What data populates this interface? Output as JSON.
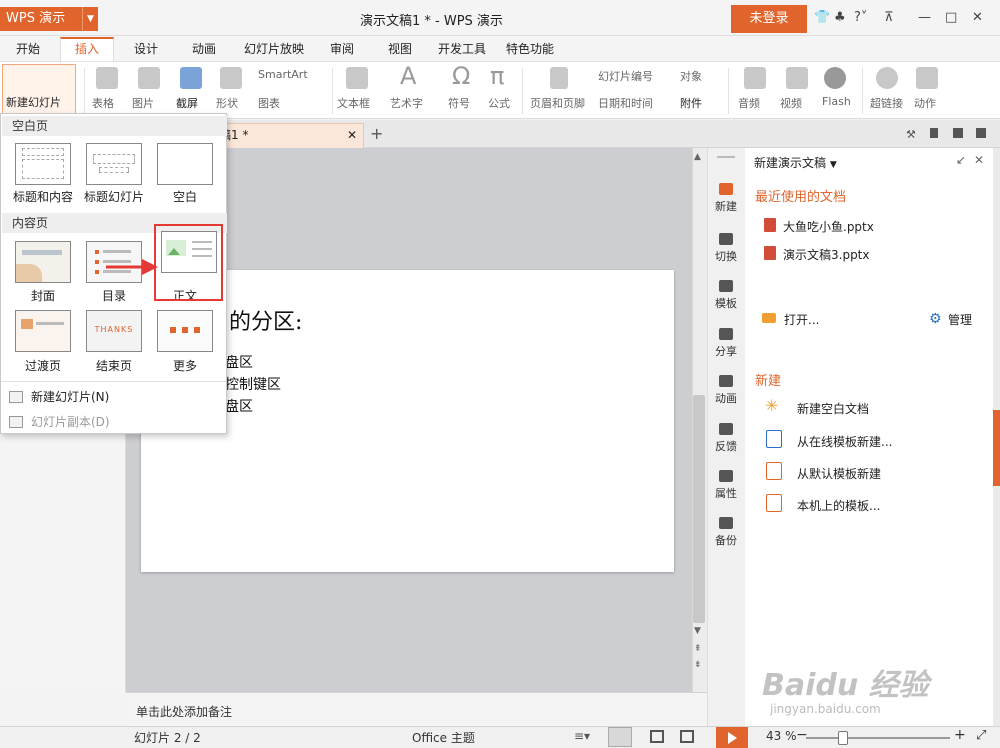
{
  "app": {
    "logo": "WPS 演示",
    "title": "演示文稿1 * - WPS 演示",
    "login": "未登录"
  },
  "menu_tabs": [
    "开始",
    "插入",
    "设计",
    "动画",
    "幻灯片放映",
    "审阅",
    "视图",
    "开发工具",
    "特色功能"
  ],
  "ribbon": {
    "new_slide": "新建幻灯片",
    "table": "表格",
    "picture": "图片",
    "screenshot": "截屏",
    "shape": "形状",
    "smartart": "SmartArt",
    "chart": "图表",
    "textbox": "文本框",
    "wordart": "艺术字",
    "symbol": "符号",
    "formula": "公式",
    "header_footer": "页眉和页脚",
    "slide_number": "幻灯片编号",
    "object": "对象",
    "date_time": "日期和时间",
    "attachment": "附件",
    "audio": "音频",
    "video": "视频",
    "flash": "Flash",
    "hyperlink": "超链接",
    "action": "动作"
  },
  "doc_tab": "稿1 *",
  "slide": {
    "title": "的分区:",
    "lines": [
      "盘区",
      "控制键区",
      "盘区"
    ]
  },
  "notes_placeholder": "单击此处添加备注",
  "dropdown": {
    "section_blank": "空白页",
    "blank_layouts": [
      "标题和内容",
      "标题幻灯片",
      "空白"
    ],
    "section_content": "内容页",
    "content_layouts": [
      "封面",
      "目录",
      "正文",
      "过渡页",
      "结束页",
      "更多"
    ],
    "thanks_text": "THANKS",
    "menu_new_slide": "新建幻灯片(N)",
    "menu_duplicate": "幻灯片副本(D)"
  },
  "side_icons": [
    "新建",
    "切换",
    "模板",
    "分享",
    "动画",
    "反馈",
    "属性",
    "备份"
  ],
  "taskpane": {
    "header": "新建演示文稿",
    "recent_title": "最近使用的文档",
    "recent_files": [
      "大鱼吃小鱼.pptx",
      "演示文稿3.pptx"
    ],
    "open": "打开...",
    "manage": "管理",
    "new_title": "新建",
    "new_items": [
      "新建空白文档",
      "从在线模板新建...",
      "从默认模板新建",
      "本机上的模板..."
    ]
  },
  "status": {
    "slide_info": "幻灯片 2 / 2",
    "theme": "Office 主题",
    "zoom": "43 %"
  },
  "watermark": {
    "brand": "Baidu 经验",
    "url": "jingyan.baidu.com"
  },
  "colors": {
    "accent": "#e0642c",
    "highlight": "#e53935"
  }
}
